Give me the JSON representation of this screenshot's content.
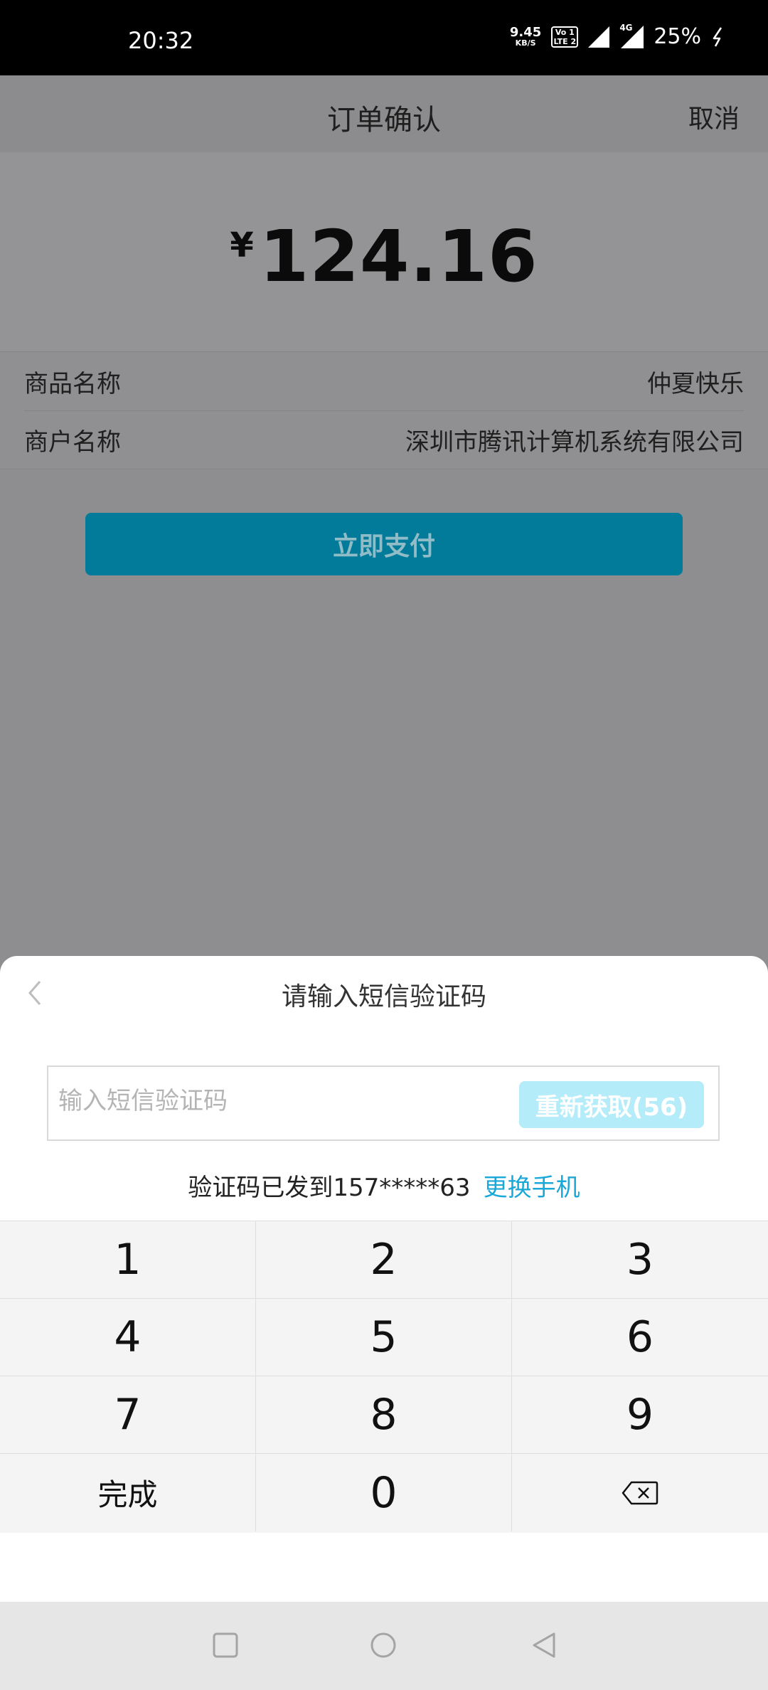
{
  "status_bar": {
    "time": "20:32",
    "net_speed": "9.45",
    "net_unit": "KB/S",
    "volte_top": "Vo 1",
    "volte_bottom": "LTE 2",
    "network_type": "4G",
    "battery": "25%"
  },
  "header": {
    "title": "订单确认",
    "cancel_label": "取消"
  },
  "amount": {
    "currency": "¥",
    "value": "124.16"
  },
  "info": [
    {
      "label": "商品名称",
      "value": "仲夏快乐"
    },
    {
      "label": "商户名称",
      "value": "深圳市腾讯计算机系统有限公司"
    }
  ],
  "pay_button_label": "立即支付",
  "sms_sheet": {
    "title": "请输入短信验证码",
    "input_value": "",
    "input_placeholder": "输入短信验证码",
    "resend_label": "重新获取(56)",
    "sent_text": "验证码已发到157*****63",
    "change_phone_label": "更换手机"
  },
  "keypad": {
    "keys": [
      "1",
      "2",
      "3",
      "4",
      "5",
      "6",
      "7",
      "8",
      "9",
      "完成",
      "0"
    ],
    "delete_icon": "backspace-icon"
  },
  "nav": {
    "icons": [
      "recent-apps-icon",
      "home-icon",
      "back-nav-icon"
    ]
  },
  "colors": {
    "pay_button": "#027b9a",
    "resend_button": "#b4ecf9",
    "link": "#1aa8d8",
    "overlay": "#8e8e90"
  }
}
